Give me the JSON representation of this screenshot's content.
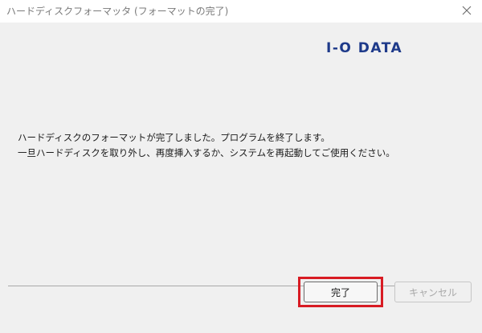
{
  "window": {
    "title": "ハードディスクフォーマッタ (フォーマットの完了)",
    "close_icon": "close-icon"
  },
  "brand": {
    "logo_text": "I-O DATA",
    "logo_color": "#1e3a8a"
  },
  "message": {
    "line1": "ハードディスクのフォーマットが完了しました。プログラムを終了します。",
    "line2": "一旦ハードディスクを取り外し、再度挿入するか、システムを再起動してご使用ください。"
  },
  "buttons": {
    "ok_label": "完了",
    "cancel_label": "キャンセル",
    "cancel_enabled": false
  },
  "colors": {
    "highlight": "#d81b23",
    "disabled_text": "#a8a8a8"
  }
}
